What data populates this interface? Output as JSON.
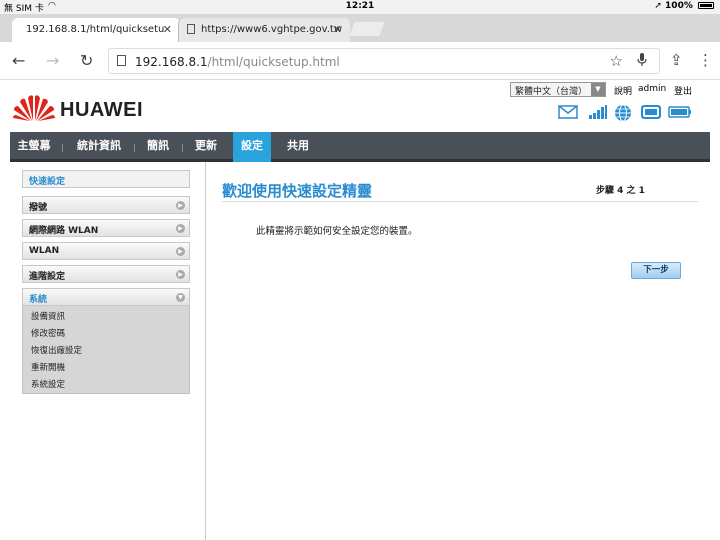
{
  "statusbar": {
    "left": "無 SIM 卡",
    "time": "12:21",
    "battery": "100%"
  },
  "browser": {
    "tabs": [
      {
        "title": "192.168.8.1/html/quicksetu"
      },
      {
        "title": "https://www6.vghtpe.gov.tw"
      }
    ],
    "url_host": "192.168.8.1",
    "url_path": "/html/quicksetup.html"
  },
  "header": {
    "language": "繁體中文（台灣）",
    "help": "說明",
    "user": "admin",
    "logout": "登出",
    "brand": "HUAWEI",
    "colors": {
      "brand_red": "#e2231a",
      "accent": "#2a8ccf",
      "nav_bg": "#4a5057"
    }
  },
  "nav": {
    "items": [
      {
        "label": "主螢幕"
      },
      {
        "label": "統計資訊"
      },
      {
        "label": "簡訊"
      },
      {
        "label": "更新"
      },
      {
        "label": "設定"
      },
      {
        "label": "共用"
      }
    ]
  },
  "sidebar": {
    "quick": "快速設定",
    "sections": [
      {
        "label": "撥號"
      },
      {
        "label": "網際網路 WLAN"
      },
      {
        "label": "WLAN"
      },
      {
        "label": "進階設定"
      },
      {
        "label": "系統"
      }
    ],
    "system_items": [
      "設備資訊",
      "修改密碼",
      "恢復出廠設定",
      "重新開機",
      "系統設定"
    ]
  },
  "main": {
    "title": "歡迎使用快速設定精靈",
    "step": "步驟 4 之 1",
    "description": "此精靈將示範如何安全設定您的裝置。",
    "next": "下一步"
  }
}
